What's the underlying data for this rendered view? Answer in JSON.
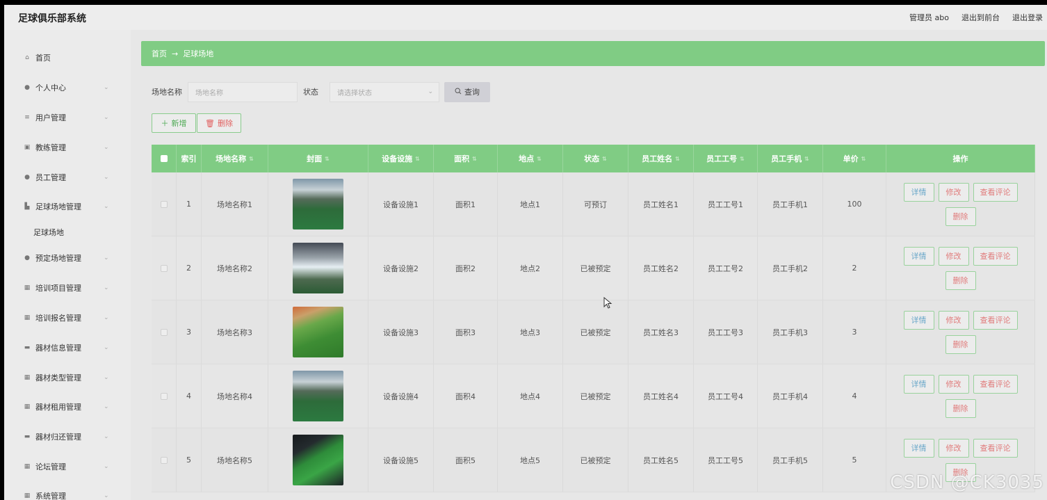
{
  "app": {
    "title": "足球俱乐部系统"
  },
  "top_links": {
    "user": "管理员 abo",
    "front": "退出到前台",
    "logout": "退出登录"
  },
  "sidebar": {
    "items": [
      {
        "label": "首页",
        "icon": "home-icon",
        "glyph": "⌂",
        "arrow": false
      },
      {
        "label": "个人中心",
        "icon": "person-icon",
        "glyph": "●",
        "arrow": true
      },
      {
        "label": "用户管理",
        "icon": "list-icon",
        "glyph": "≡",
        "arrow": true
      },
      {
        "label": "教练管理",
        "icon": "calendar-icon",
        "glyph": "▣",
        "arrow": true
      },
      {
        "label": "员工管理",
        "icon": "person-icon",
        "glyph": "●",
        "arrow": true
      },
      {
        "label": "足球场地管理",
        "icon": "bar-chart-icon",
        "glyph": "▙",
        "arrow": true
      },
      {
        "label": "预定场地管理",
        "icon": "location-icon",
        "glyph": "●",
        "arrow": true
      },
      {
        "label": "培训项目管理",
        "icon": "grid-icon",
        "glyph": "▦",
        "arrow": true
      },
      {
        "label": "培训报名管理",
        "icon": "grid-icon",
        "glyph": "▦",
        "arrow": true
      },
      {
        "label": "器材信息管理",
        "icon": "monitor-icon",
        "glyph": "▬",
        "arrow": true
      },
      {
        "label": "器材类型管理",
        "icon": "grid-icon",
        "glyph": "▦",
        "arrow": true
      },
      {
        "label": "器材租用管理",
        "icon": "grid-icon",
        "glyph": "▦",
        "arrow": true
      },
      {
        "label": "器材归还管理",
        "icon": "monitor-icon",
        "glyph": "▬",
        "arrow": true
      },
      {
        "label": "论坛管理",
        "icon": "grid-icon",
        "glyph": "▦",
        "arrow": true
      },
      {
        "label": "系统管理",
        "icon": "grid-icon",
        "glyph": "▦",
        "arrow": true
      }
    ],
    "sub_item": "足球场地"
  },
  "breadcrumb": {
    "home": "首页",
    "arrow": "→",
    "current": "足球场地"
  },
  "search": {
    "name_label": "场地名称",
    "name_placeholder": "场地名称",
    "status_label": "状态",
    "status_placeholder": "请选择状态",
    "query": "查询"
  },
  "actions": {
    "add": "新增",
    "delete": "删除"
  },
  "table": {
    "headers": [
      "索引",
      "场地名称",
      "封面",
      "设备设施",
      "面积",
      "地点",
      "状态",
      "员工姓名",
      "员工工号",
      "员工手机",
      "单价",
      "操作"
    ],
    "ops": {
      "detail": "详情",
      "edit": "修改",
      "review": "查看评论",
      "remove": "删除"
    },
    "rows": [
      {
        "index": "1",
        "name": "场地名称1",
        "facility": "设备设施1",
        "area": "面积1",
        "place": "地点1",
        "status": "可预订",
        "staff_name": "员工姓名1",
        "staff_no": "员工工号1",
        "staff_phone": "员工手机1",
        "price": "100"
      },
      {
        "index": "2",
        "name": "场地名称2",
        "facility": "设备设施2",
        "area": "面积2",
        "place": "地点2",
        "status": "已被预定",
        "staff_name": "员工姓名2",
        "staff_no": "员工工号2",
        "staff_phone": "员工手机2",
        "price": "2"
      },
      {
        "index": "3",
        "name": "场地名称3",
        "facility": "设备设施3",
        "area": "面积3",
        "place": "地点3",
        "status": "已被预定",
        "staff_name": "员工姓名3",
        "staff_no": "员工工号3",
        "staff_phone": "员工手机3",
        "price": "3"
      },
      {
        "index": "4",
        "name": "场地名称4",
        "facility": "设备设施4",
        "area": "面积4",
        "place": "地点4",
        "status": "已被预定",
        "staff_name": "员工姓名4",
        "staff_no": "员工工号4",
        "staff_phone": "员工手机4",
        "price": "4"
      },
      {
        "index": "5",
        "name": "场地名称5",
        "facility": "设备设施5",
        "area": "面积5",
        "place": "地点5",
        "status": "已被预定",
        "staff_name": "员工姓名5",
        "staff_no": "员工工号5",
        "staff_phone": "员工手机5",
        "price": "5"
      }
    ]
  },
  "watermark": "CSDN @CK3035",
  "colors": {
    "accent": "#80cc84",
    "danger": "#e07b7b",
    "info": "#6aa7c9"
  }
}
